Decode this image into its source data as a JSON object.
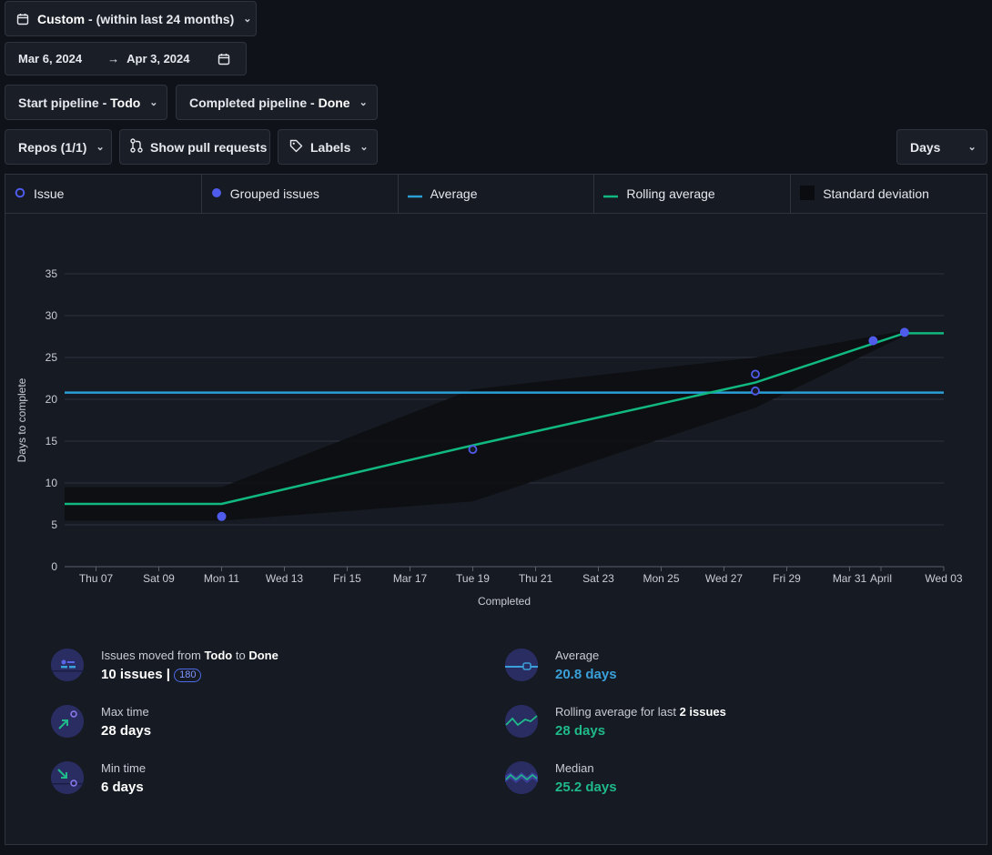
{
  "filters": {
    "range_prefix": "Custom",
    "range_suffix": " - (within last 24 months)",
    "date_from": "Mar 6, 2024",
    "arrow": "→",
    "date_to": "Apr 3, 2024",
    "start_pipeline_prefix": "Start pipeline - ",
    "start_pipeline_value": "Todo",
    "completed_pipeline_prefix": "Completed pipeline - ",
    "completed_pipeline_value": "Done",
    "repos": "Repos (1/1)",
    "show_prs": "Show pull requests",
    "labels": "Labels",
    "unit": "Days"
  },
  "legend": {
    "issue": "Issue",
    "grouped": "Grouped issues",
    "average": "Average",
    "rolling": "Rolling average",
    "stddev": "Standard deviation"
  },
  "colors": {
    "issue": "#4f5bea",
    "grouped": "#4f5bea",
    "average": "#2a9fd6",
    "rolling": "#11b87f",
    "stddev": "#0d0e11"
  },
  "chart_data": {
    "type": "scatter",
    "xlabel": "Completed",
    "ylabel": "Days to complete",
    "ylim": [
      0,
      35
    ],
    "yticks": [
      0,
      5,
      10,
      15,
      20,
      25,
      30,
      35
    ],
    "xlim": [
      "2024-03-06",
      "2024-04-03"
    ],
    "xtick_labels": [
      {
        "date": "2024-03-07",
        "label": "Thu 07"
      },
      {
        "date": "2024-03-09",
        "label": "Sat 09"
      },
      {
        "date": "2024-03-11",
        "label": "Mon 11"
      },
      {
        "date": "2024-03-13",
        "label": "Wed 13"
      },
      {
        "date": "2024-03-15",
        "label": "Fri 15"
      },
      {
        "date": "2024-03-17",
        "label": "Mar 17"
      },
      {
        "date": "2024-03-19",
        "label": "Tue 19"
      },
      {
        "date": "2024-03-21",
        "label": "Thu 21"
      },
      {
        "date": "2024-03-23",
        "label": "Sat 23"
      },
      {
        "date": "2024-03-25",
        "label": "Mon 25"
      },
      {
        "date": "2024-03-27",
        "label": "Wed 27"
      },
      {
        "date": "2024-03-29",
        "label": "Fri 29"
      },
      {
        "date": "2024-03-31",
        "label": "Mar 31"
      },
      {
        "date": "2024-04-01",
        "label": "April"
      },
      {
        "date": "2024-04-03",
        "label": "Wed 03"
      }
    ],
    "issues": [
      {
        "date": "2024-03-19",
        "days": 14
      },
      {
        "date": "2024-03-28",
        "days": 23
      },
      {
        "date": "2024-03-28",
        "days": 21
      }
    ],
    "grouped_issues": [
      {
        "date": "2024-03-11",
        "days": 6
      },
      {
        "date": "2024-03-31T18:00",
        "days": 27
      },
      {
        "date": "2024-04-01T18:00",
        "days": 28
      }
    ],
    "average": 20.8,
    "rolling_average": [
      {
        "date": "2024-03-06",
        "days": 7.5
      },
      {
        "date": "2024-03-11",
        "days": 7.5
      },
      {
        "date": "2024-03-19",
        "days": 14.5
      },
      {
        "date": "2024-03-28",
        "days": 22
      },
      {
        "date": "2024-04-01T18:00",
        "days": 27.9
      },
      {
        "date": "2024-04-03",
        "days": 27.9
      }
    ],
    "stddev_band": {
      "upper": [
        {
          "date": "2024-03-06",
          "days": 9.5
        },
        {
          "date": "2024-03-11",
          "days": 9.5
        },
        {
          "date": "2024-03-19",
          "days": 21.2
        },
        {
          "date": "2024-03-28",
          "days": 25
        },
        {
          "date": "2024-04-01T18:00",
          "days": 28.2
        }
      ],
      "lower": [
        {
          "date": "2024-04-01T18:00",
          "days": 27.6
        },
        {
          "date": "2024-03-28",
          "days": 19
        },
        {
          "date": "2024-03-19",
          "days": 7.8
        },
        {
          "date": "2024-03-11",
          "days": 5.5
        },
        {
          "date": "2024-03-06",
          "days": 5.5
        }
      ]
    }
  },
  "stats": {
    "issues_moved_prefix": "Issues moved from ",
    "issues_moved_from": "Todo",
    "issues_moved_to_word": " to ",
    "issues_moved_to": "Done",
    "issues_count": "10 issues |",
    "issues_total": "180",
    "max_label": "Max time",
    "max_value": "28 days",
    "min_label": "Min time",
    "min_value": "6 days",
    "avg_label": "Average",
    "avg_value": "20.8 days",
    "rolling_prefix": "Rolling average for last ",
    "rolling_count": "2 issues",
    "rolling_value": "28 days",
    "median_label": "Median",
    "median_value": "25.2 days"
  }
}
